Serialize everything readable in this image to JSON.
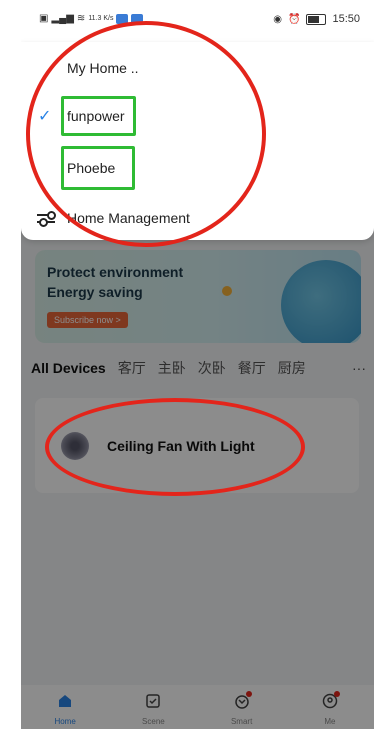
{
  "status_bar": {
    "left_icons": [
      "sim-icon",
      "signal-icon",
      "wifi-icon",
      "speed-text",
      "app-badge-icon",
      "app-badge-icon"
    ],
    "speed": "11.3 K/s",
    "time": "15:50"
  },
  "menu": {
    "items": [
      {
        "label": "My Home ..",
        "checked": false
      },
      {
        "label": "funpower",
        "checked": true
      },
      {
        "label": "Phoebe",
        "checked": false
      }
    ],
    "management_label": "Home Management"
  },
  "banner": {
    "line1": "Protect environment",
    "line2": "Energy saving",
    "button": "Subscribe now >"
  },
  "tabs": {
    "items": [
      "All Devices",
      "客厅",
      "主卧",
      "次卧",
      "餐厅",
      "厨房"
    ],
    "more": "···"
  },
  "device": {
    "name": "Ceiling Fan With Light"
  },
  "nav": {
    "items": [
      {
        "label": "Home",
        "icon": "home-icon",
        "active": true
      },
      {
        "label": "Scene",
        "icon": "scene-icon",
        "active": false
      },
      {
        "label": "Smart",
        "icon": "smart-icon",
        "active": false
      },
      {
        "label": "Me",
        "icon": "me-icon",
        "active": false
      }
    ]
  },
  "colors": {
    "accent": "#2a83e6",
    "annotation_red": "#e3251b",
    "annotation_green": "#2fbb34"
  }
}
